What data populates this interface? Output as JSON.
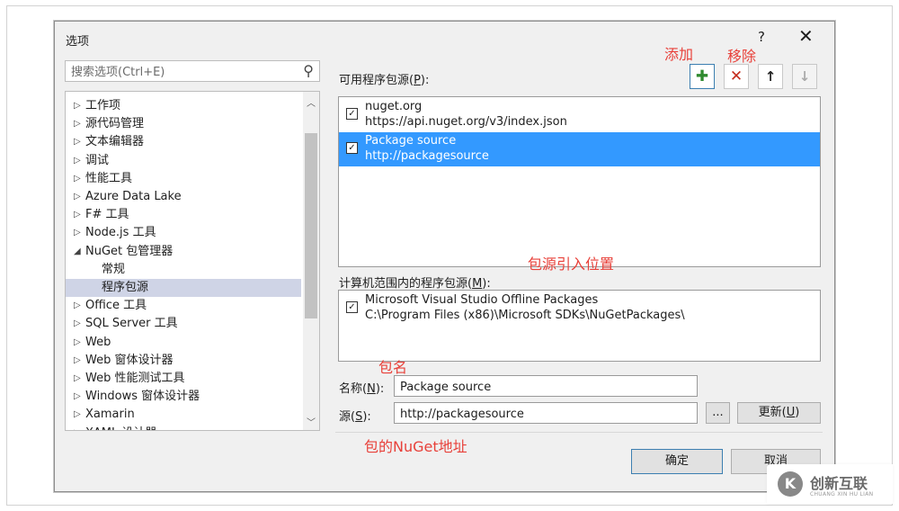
{
  "dialog": {
    "title": "选项",
    "help": "?",
    "close": "✕",
    "search": {
      "placeholder": "搜索选项(Ctrl+E)"
    },
    "tree": [
      {
        "label": "工作项",
        "arrow": "▷",
        "level": 0,
        "selected": false
      },
      {
        "label": "源代码管理",
        "arrow": "▷",
        "level": 0,
        "selected": false
      },
      {
        "label": "文本编辑器",
        "arrow": "▷",
        "level": 0,
        "selected": false
      },
      {
        "label": "调试",
        "arrow": "▷",
        "level": 0,
        "selected": false
      },
      {
        "label": "性能工具",
        "arrow": "▷",
        "level": 0,
        "selected": false
      },
      {
        "label": "Azure Data Lake",
        "arrow": "▷",
        "level": 0,
        "selected": false
      },
      {
        "label": "F# 工具",
        "arrow": "▷",
        "level": 0,
        "selected": false
      },
      {
        "label": "Node.js 工具",
        "arrow": "▷",
        "level": 0,
        "selected": false
      },
      {
        "label": "NuGet 包管理器",
        "arrow": "◢",
        "level": 0,
        "selected": false
      },
      {
        "label": "常规",
        "arrow": "",
        "level": 1,
        "selected": false
      },
      {
        "label": "程序包源",
        "arrow": "",
        "level": 1,
        "selected": true
      },
      {
        "label": "Office 工具",
        "arrow": "▷",
        "level": 0,
        "selected": false
      },
      {
        "label": "SQL Server 工具",
        "arrow": "▷",
        "level": 0,
        "selected": false
      },
      {
        "label": "Web",
        "arrow": "▷",
        "level": 0,
        "selected": false
      },
      {
        "label": "Web 窗体设计器",
        "arrow": "▷",
        "level": 0,
        "selected": false
      },
      {
        "label": "Web 性能测试工具",
        "arrow": "▷",
        "level": 0,
        "selected": false
      },
      {
        "label": "Windows 窗体设计器",
        "arrow": "▷",
        "level": 0,
        "selected": false
      },
      {
        "label": "Xamarin",
        "arrow": "▷",
        "level": 0,
        "selected": false
      },
      {
        "label": "XAML 设计器",
        "arrow": "▷",
        "level": 0,
        "selected": false
      }
    ],
    "available": {
      "label_pre": "可用程序包源(",
      "label_key": "P",
      "label_post": "):",
      "sources": [
        {
          "name": "nuget.org",
          "url": "https://api.nuget.org/v3/index.json",
          "checked": true,
          "selected": false
        },
        {
          "name": "Package source",
          "url": "http://packagesource",
          "checked": true,
          "selected": true
        }
      ]
    },
    "toolbar": {
      "add": "✚",
      "remove": "✕",
      "up": "↑",
      "down": "↓"
    },
    "machine": {
      "label_pre": "计算机范围内的程序包源(",
      "label_key": "M",
      "label_post": "):",
      "sources": [
        {
          "name": "Microsoft Visual Studio Offline Packages",
          "url": "C:\\Program Files (x86)\\Microsoft SDKs\\NuGetPackages\\",
          "checked": true
        }
      ]
    },
    "fields": {
      "name_pre": "名称(",
      "name_key": "N",
      "name_post": "):",
      "name_value": "Package source",
      "source_pre": "源(",
      "source_key": "S",
      "source_post": "):",
      "source_value": "http://packagesource",
      "browse": "...",
      "update_pre": "更新(",
      "update_key": "U",
      "update_post": ")"
    },
    "buttons": {
      "ok": "确定",
      "cancel": "取消"
    }
  },
  "annotations": {
    "add": "添加",
    "remove": "移除",
    "position": "包源引入位置",
    "name": "包名",
    "url": "包的NuGet地址"
  },
  "watermark": {
    "logo": "K",
    "text": "创新互联",
    "sub": "CHUANG XIN HU LIAN"
  },
  "colors": {
    "selection": "#3399ff",
    "annotation": "#e8413a",
    "tree_selection": "#cfd4e6"
  }
}
